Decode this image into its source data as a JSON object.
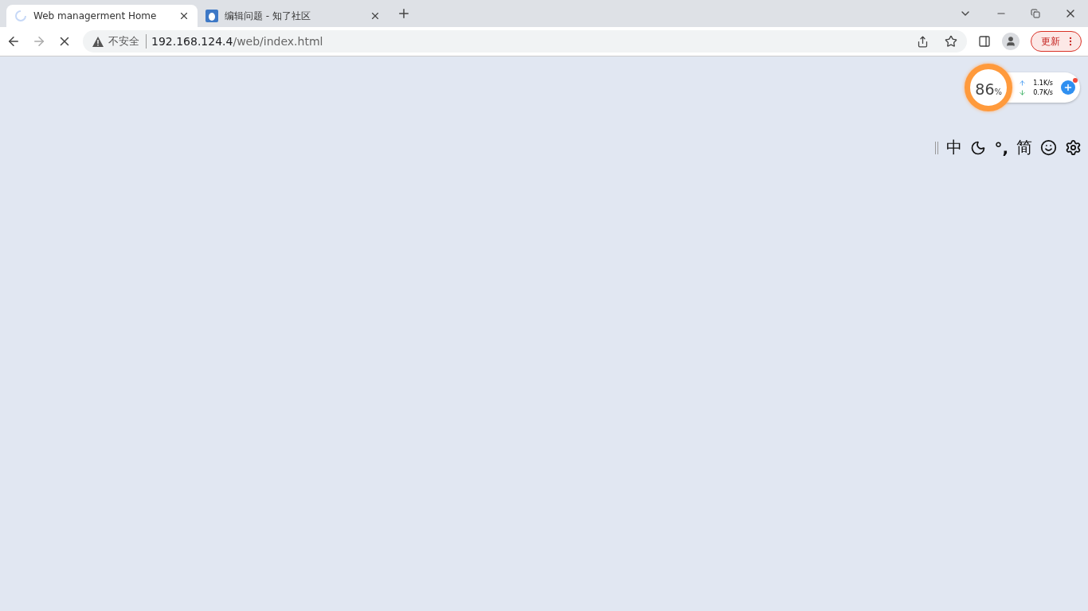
{
  "tabs": [
    {
      "title": "Web managerment Home",
      "selected": true,
      "kind": "loading"
    },
    {
      "title": "编辑问题 - 知了社区",
      "selected": false,
      "kind": "site"
    }
  ],
  "address_bar": {
    "security": "不安全",
    "url_host": "192.168.124.4",
    "url_path": "/web/index.html"
  },
  "update_button": "更新",
  "speed_widget": {
    "percent": "86",
    "unit": "%",
    "upload": "1.1K/s",
    "download": "0.7K/s"
  },
  "ime_toolbar": {
    "mode": "中",
    "punctuation": "°,",
    "script": "简"
  }
}
